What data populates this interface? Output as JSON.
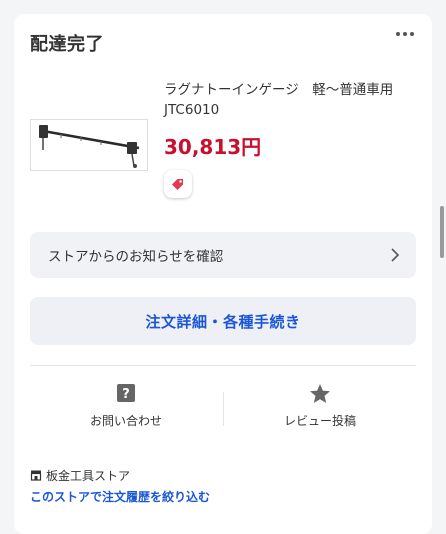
{
  "order": {
    "status": "配達完了",
    "more_icon": "more-horizontal-icon"
  },
  "product": {
    "name": "ラグナトーインゲージ　軽〜普通車用　JTC6010",
    "price": "30,813円",
    "tag_icon": "price-tag-icon"
  },
  "notice": {
    "label": "ストアからのお知らせを確認"
  },
  "order_details": {
    "label": "注文詳細・各種手続き"
  },
  "actions": [
    {
      "label": "お問い合わせ",
      "icon": "question-icon"
    },
    {
      "label": "レビュー投稿",
      "icon": "star-icon"
    }
  ],
  "store": {
    "name": "板金工具ストア",
    "filter_link": "このストアで注文履歴を絞り込む"
  },
  "colors": {
    "price": "#c8102e",
    "link": "#1b56d8",
    "tag": "#e23a4f"
  }
}
